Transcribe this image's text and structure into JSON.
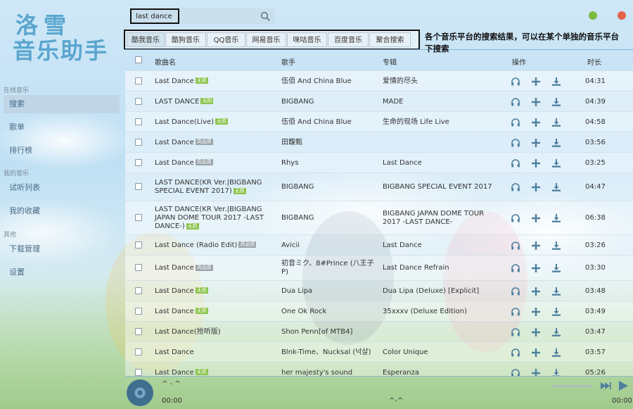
{
  "app": {
    "logo_line1": "洛雪",
    "logo_line2": "音乐助手"
  },
  "colors": {
    "accent": "#5aa6cf",
    "icon": "#4d7f9e",
    "badge_green": "#8ac34a",
    "badge_gray": "#9aa4ab",
    "window_green": "#7dbb3f",
    "window_red": "#e2634a"
  },
  "sidebar": {
    "groups": [
      {
        "title": "在线音乐",
        "items": [
          {
            "label": "搜索",
            "active": true
          },
          {
            "label": "歌单"
          },
          {
            "label": "排行榜"
          }
        ]
      },
      {
        "title": "我的音乐",
        "items": [
          {
            "label": "试听列表"
          },
          {
            "label": "我的收藏"
          }
        ]
      },
      {
        "title": "其他",
        "items": [
          {
            "label": "下载管理"
          },
          {
            "label": "设置"
          }
        ]
      }
    ]
  },
  "search": {
    "value": "last dance",
    "icon": "search-icon"
  },
  "tabs": [
    "酷我音乐",
    "酷狗音乐",
    "QQ音乐",
    "网易音乐",
    "咪咕音乐",
    "百度音乐",
    "聚合搜索"
  ],
  "annotation": "各个音乐平台的搜索结果，可以在某个单独的音乐平台下搜索",
  "table": {
    "headers": {
      "name": "歌曲名",
      "artist": "歌手",
      "album": "专辑",
      "ops": "操作",
      "duration": "时长"
    },
    "rows": [
      {
        "name": "Last Dance",
        "badge": "无损",
        "badge_type": "green",
        "artist": "伍佰 And China Blue",
        "album": "爱情的尽头",
        "duration": "04:31"
      },
      {
        "name": "LAST DANCE",
        "badge": "无损",
        "badge_type": "green",
        "artist": "BIGBANG",
        "album": "MADE",
        "duration": "04:39"
      },
      {
        "name": "Last Dance(Live)",
        "badge": "无损",
        "badge_type": "green",
        "artist": "伍佰 And China Blue",
        "album": "生命的现场 Life Live",
        "duration": "04:58"
      },
      {
        "name": "Last Dance",
        "badge": "高品质",
        "badge_type": "gray",
        "artist": "田馥甄",
        "album": "",
        "duration": "03:56"
      },
      {
        "name": "Last Dance",
        "badge": "高品质",
        "badge_type": "gray",
        "artist": "Rhys",
        "album": "Last Dance",
        "duration": "03:25"
      },
      {
        "name": "LAST DANCE(KR Ver.|BIGBANG SPECIAL EVENT 2017)",
        "badge": "无损",
        "badge_type": "green",
        "artist": "BIGBANG",
        "album": "BIGBANG SPECIAL EVENT 2017",
        "duration": "04:47"
      },
      {
        "name": "LAST DANCE(KR Ver.|BIGBANG JAPAN DOME TOUR 2017 -LAST DANCE-)",
        "badge": "无损",
        "badge_type": "green",
        "artist": "BIGBANG",
        "album": "BIGBANG JAPAN DOME TOUR 2017 -LAST DANCE-",
        "duration": "06:38"
      },
      {
        "name": "Last Dance (Radio Edit)",
        "badge": "高品质",
        "badge_type": "gray",
        "artist": "Avicii",
        "album": "Last Dance",
        "duration": "03:26"
      },
      {
        "name": "Last Dance",
        "badge": "高品质",
        "badge_type": "gray",
        "artist": "初音ミク、8#Prince (八王子P)",
        "album": "Last Dance Refrain",
        "duration": "03:30"
      },
      {
        "name": "Last Dance",
        "badge": "无损",
        "badge_type": "green",
        "artist": "Dua Lipa",
        "album": "Dua Lipa (Deluxe) [Explicit]",
        "duration": "03:48"
      },
      {
        "name": "Last Dance",
        "badge": "无损",
        "badge_type": "green",
        "artist": "One Ok Rock",
        "album": "35xxxv (Deluxe Edition)",
        "duration": "03:49"
      },
      {
        "name": "Last Dance(抢听版)",
        "badge": "",
        "badge_type": "",
        "artist": "Shon Penn[of MTB4]",
        "album": "",
        "duration": "03:47"
      },
      {
        "name": "Last Dance",
        "badge": "",
        "badge_type": "",
        "artist": "Blnk-Time、Nucksal (넉살)",
        "album": "Color Unique",
        "duration": "03:57"
      },
      {
        "name": "Last Dance",
        "badge": "无损",
        "badge_type": "green",
        "artist": "her majesty's sound",
        "album": "Esperanza",
        "duration": "05:26"
      }
    ],
    "ops": [
      "headphones-icon",
      "plus-icon",
      "download-icon"
    ]
  },
  "player": {
    "title": "^ - ^",
    "time_left": "00:00",
    "center_text": "^-^",
    "time_right": "00:00",
    "controls": [
      "next-icon",
      "play-icon"
    ]
  }
}
